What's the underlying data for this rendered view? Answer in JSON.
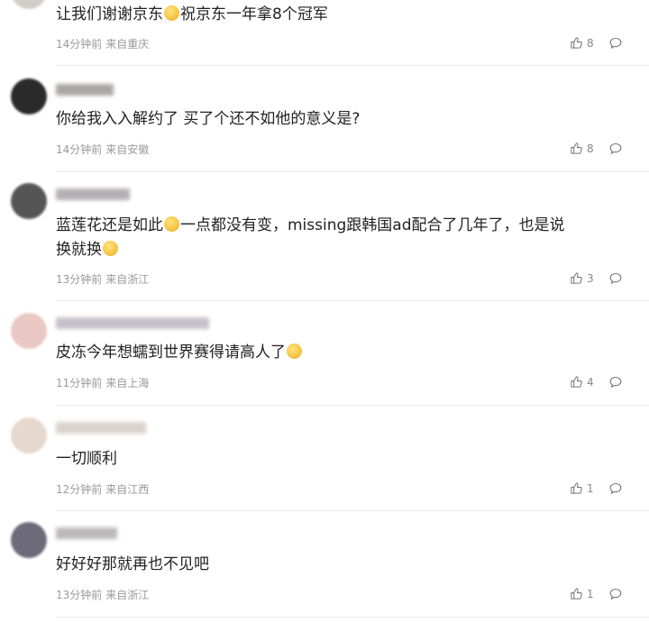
{
  "comments": [
    {
      "avatar_color": "#d0ccc8",
      "username_color": "#c9c4be",
      "text": "让我们谢谢京东😊祝京东一年拿8个冠军",
      "time": "14分钟前",
      "location": "来自重庆",
      "likes": "8"
    },
    {
      "avatar_color": "#2a2a2a",
      "username_color": "#9c9894",
      "text": "你给我入入解约了 买了个还不如他的意义是?",
      "time": "14分钟前",
      "location": "来自安徽",
      "likes": "8"
    },
    {
      "avatar_color": "#555555",
      "username_color": "#a8a2a6",
      "text": "蓝莲花还是如此😹一点都没有变，missing跟韩国ad配合了几年了，也是说",
      "text_line2": "换就换😹",
      "time": "13分钟前",
      "location": "来自浙江",
      "likes": "3"
    },
    {
      "avatar_color": "#e9c8c3",
      "username_color": "#bcb6c2",
      "text": "皮冻今年想蠕到世界赛得请高人了🙂",
      "time": "11分钟前",
      "location": "来自上海",
      "likes": "4"
    },
    {
      "avatar_color": "#e6d8cc",
      "username_color": "#d2cbc4",
      "text": "一切顺利",
      "time": "12分钟前",
      "location": "来自江西",
      "likes": "1"
    },
    {
      "avatar_color": "#6d6a7a",
      "username_color": "#b0acae",
      "text": "好好好那就再也不见吧",
      "time": "13分钟前",
      "location": "来自浙江",
      "likes": "1"
    }
  ],
  "colors": {
    "text": "#222222",
    "meta": "#999999",
    "divider": "#ececec"
  }
}
